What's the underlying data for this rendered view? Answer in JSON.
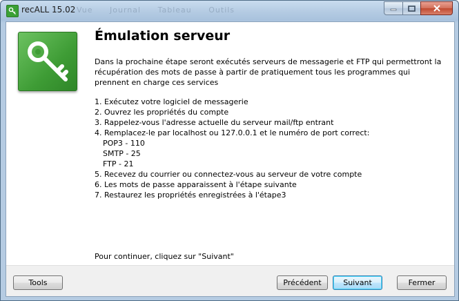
{
  "window": {
    "title": "recALL 15.02",
    "ghost_menu": [
      "Vue",
      "Journal",
      "Tableau",
      "Outils"
    ]
  },
  "page": {
    "heading": "Émulation serveur",
    "intro": "Dans la prochaine étape seront exécutés serveurs de messagerie et FTP qui permettront la récupération des mots de passe à partir de pratiquement tous les programmes qui prennent en charge ces services",
    "steps": [
      "1. Exécutez votre logiciel de messagerie",
      "2. Ouvrez les propriétés du compte",
      "3. Rappelez-vous l'adresse actuelle du serveur mail/ftp entrant",
      "4. Remplacez-le par localhost ou 127.0.0.1 et le numéro de port correct:"
    ],
    "ports": [
      "POP3 - 110",
      "SMTP - 25",
      "FTP - 21"
    ],
    "steps_after": [
      "5. Recevez du courrier ou connectez-vous au serveur de votre compte",
      "6. Les mots de passe apparaissent à l'étape suivante",
      "7. Restaurez les propriétés enregistrées à l'étape3"
    ],
    "continue_text": "Pour continuer, cliquez sur \"Suivant\""
  },
  "buttons": {
    "tools": "Tools",
    "previous": "Précédent",
    "next": "Suivant",
    "close": "Fermer"
  },
  "icons": {
    "app": "key-icon",
    "main": "key-icon"
  },
  "colors": {
    "icon_green": "#3e9c35",
    "titlebar_blue": "#b7cde4"
  }
}
